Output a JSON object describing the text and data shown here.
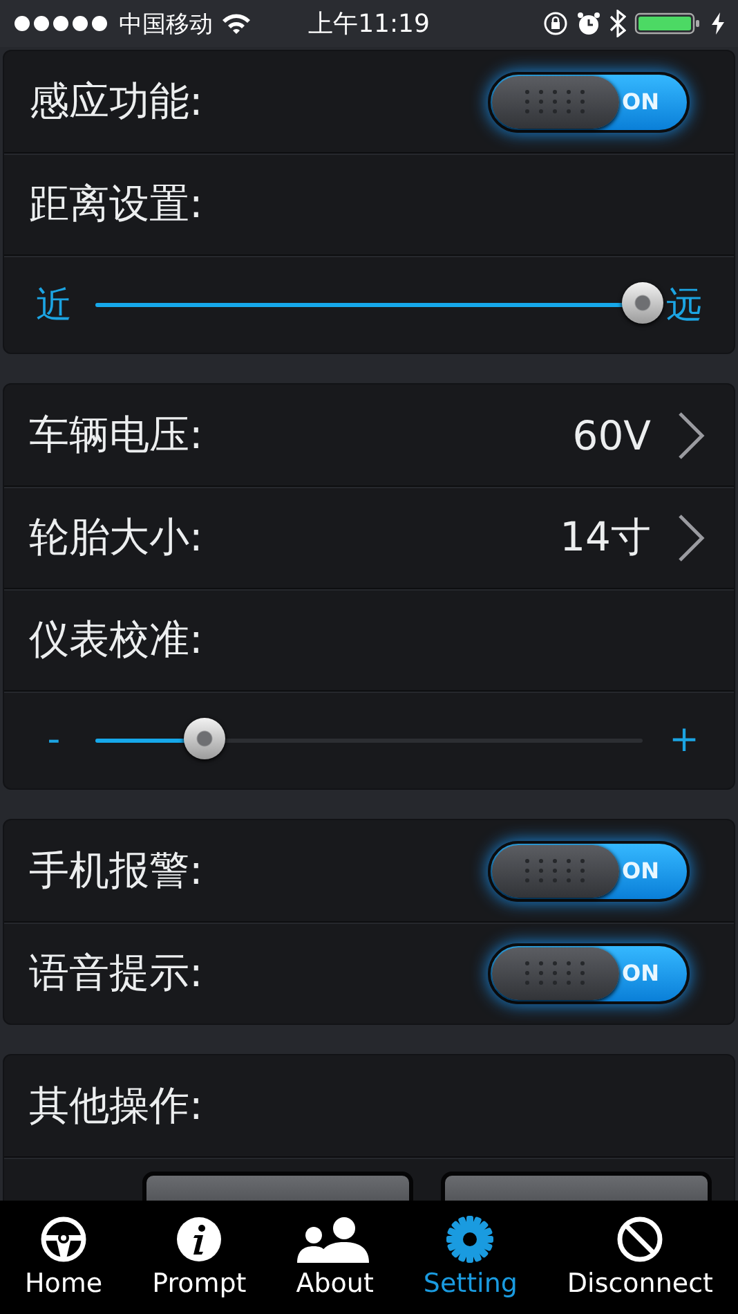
{
  "status_bar": {
    "carrier": "中国移动",
    "time": "上午11:19"
  },
  "sections": [
    {
      "rows": [
        {
          "kind": "toggle",
          "label": "感应功能:",
          "on": true,
          "switch_text": "ON"
        },
        {
          "kind": "label",
          "label": "距离设置:"
        },
        {
          "kind": "slider",
          "min_label": "近",
          "max_label": "远",
          "level": 1.0
        }
      ]
    },
    {
      "rows": [
        {
          "kind": "value",
          "label": "车辆电压:",
          "value": "60V"
        },
        {
          "kind": "value",
          "label": "轮胎大小:",
          "value": "14寸"
        },
        {
          "kind": "label",
          "label": "仪表校准:"
        },
        {
          "kind": "slider",
          "min_label": "-",
          "max_label": "+",
          "level": 0.2
        }
      ]
    },
    {
      "rows": [
        {
          "kind": "toggle",
          "label": "手机报警:",
          "on": true,
          "switch_text": "ON"
        },
        {
          "kind": "toggle",
          "label": "语音提示:",
          "on": true,
          "switch_text": "ON"
        }
      ]
    },
    {
      "rows": [
        {
          "kind": "label",
          "label": "其他操作:"
        },
        {
          "kind": "buttons"
        }
      ]
    }
  ],
  "tab_bar": [
    {
      "label": "Home",
      "selected": false
    },
    {
      "label": "Prompt",
      "selected": false
    },
    {
      "label": "About",
      "selected": false
    },
    {
      "label": "Setting",
      "selected": true
    },
    {
      "label": "Disconnect",
      "selected": false
    }
  ]
}
